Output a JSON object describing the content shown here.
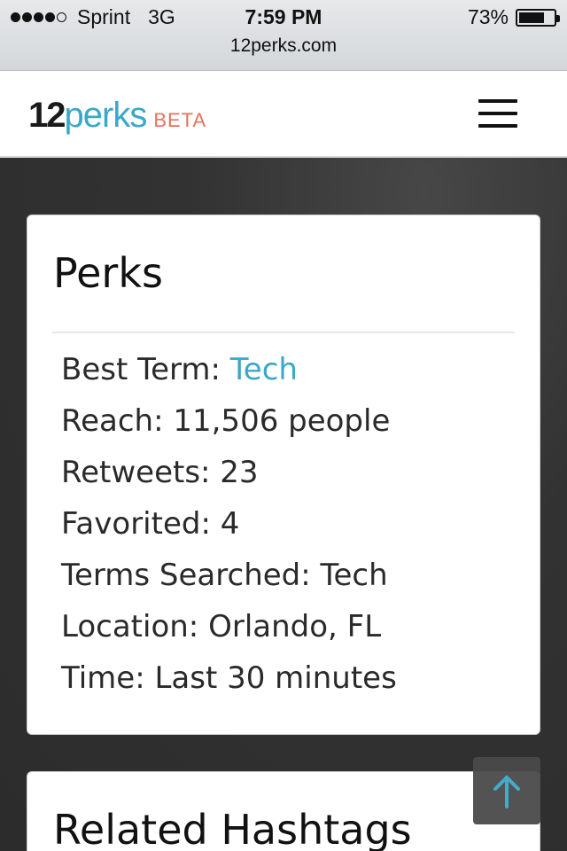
{
  "status_bar": {
    "carrier": "Sprint",
    "network": "3G",
    "time": "7:59 PM",
    "battery_percent": "73%",
    "battery_level": 0.73,
    "signal_bars": 4
  },
  "browser": {
    "url": "12perks.com"
  },
  "header": {
    "logo_number": "12",
    "logo_word": "perks",
    "logo_badge": "BETA",
    "menu_icon": "hamburger-menu-icon"
  },
  "perks_card": {
    "title": "Perks",
    "items": [
      {
        "label": "Best Term: ",
        "value": "Tech",
        "link": true
      },
      {
        "label": "Reach: ",
        "value": "11,506 people",
        "link": false
      },
      {
        "label": "Retweets: ",
        "value": "23",
        "link": false
      },
      {
        "label": "Favorited: ",
        "value": "4",
        "link": false
      },
      {
        "label": "Terms Searched: ",
        "value": "Tech",
        "link": false
      },
      {
        "label": "Location: ",
        "value": "Orlando, FL",
        "link": false
      },
      {
        "label": "Time: ",
        "value": "Last 30 minutes",
        "link": false
      }
    ]
  },
  "related_card": {
    "title": "Related Hashtags"
  },
  "scroll_top": {
    "icon": "arrow-up-icon"
  },
  "colors": {
    "accent": "#3aa8c9",
    "beta": "#e3735b",
    "background": "#2f2f2f"
  }
}
